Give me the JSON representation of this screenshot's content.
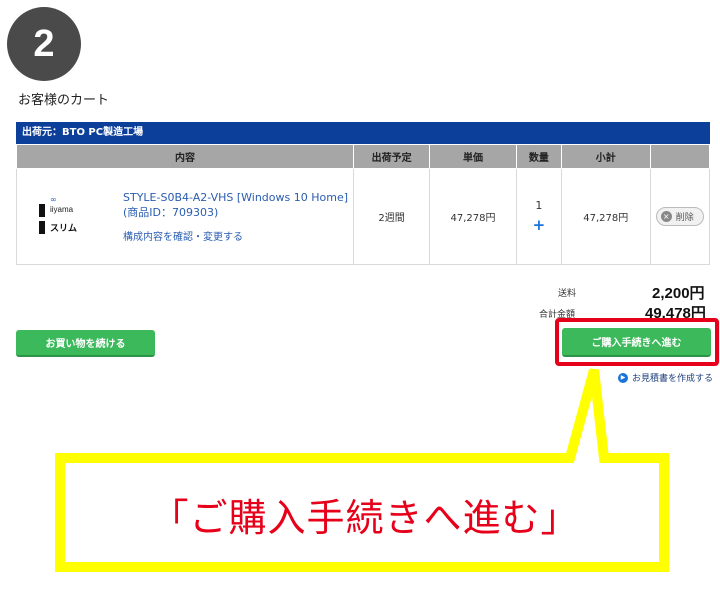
{
  "step": {
    "number": "2"
  },
  "cart": {
    "title": "お客様のカート",
    "ship_from": "出荷元：BTO PC製造工場",
    "headers": [
      "内容",
      "出荷予定",
      "単価",
      "数量",
      "小計",
      ""
    ],
    "item": {
      "logo_brand": "iiyama",
      "logo_sub": "スリム",
      "name": "STYLE-S0B4-A2-VHS [Windows 10 Home] (商品ID：709303)",
      "config_link": "構成内容を確認・変更する",
      "ship": "2週間",
      "price": "47,278円",
      "qty": "1",
      "qty_plus": "+",
      "subtotal": "47,278円",
      "delete_label": "削除",
      "delete_icon": "×"
    }
  },
  "summary": {
    "shipping_label": "送料",
    "shipping_value": "2,200円",
    "total_label": "合計金額",
    "total_value": "49,478円"
  },
  "buttons": {
    "continue_shopping": "お買い物を続ける",
    "proceed": "ご購入手続きへ進む",
    "quote": "お見積書を作成する",
    "quote_icon": "▶"
  },
  "callout": {
    "text": "「ご購入手続きへ進む」",
    "highlight_color": "#e6001a",
    "box_color": "#ffff00"
  },
  "colors": {
    "ship_bar": "#0c3f99",
    "green_button": "#3cb95b",
    "link": "#2a5db0"
  }
}
